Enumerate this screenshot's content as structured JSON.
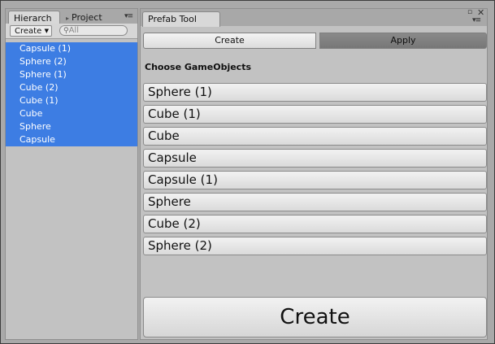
{
  "hierarchy": {
    "tab_hierarchy": "Hierarch",
    "tab_project": "Project",
    "create_label": "Create",
    "search_placeholder": "All",
    "items": [
      "Capsule (1)",
      "Sphere (2)",
      "Sphere (1)",
      "Cube (2)",
      "Cube (1)",
      "Cube",
      "Sphere",
      "Capsule"
    ]
  },
  "prefab_tool": {
    "tab_title": "Prefab Tool",
    "segment_create": "Create",
    "segment_apply": "Apply",
    "section_label": "Choose GameObjects",
    "objects": [
      "Sphere (1)",
      "Cube (1)",
      "Cube",
      "Capsule",
      "Capsule (1)",
      "Sphere",
      "Cube (2)",
      "Sphere (2)"
    ],
    "create_button": "Create"
  },
  "colors": {
    "selection": "#3d7de3",
    "panel": "#c2c2c2"
  }
}
